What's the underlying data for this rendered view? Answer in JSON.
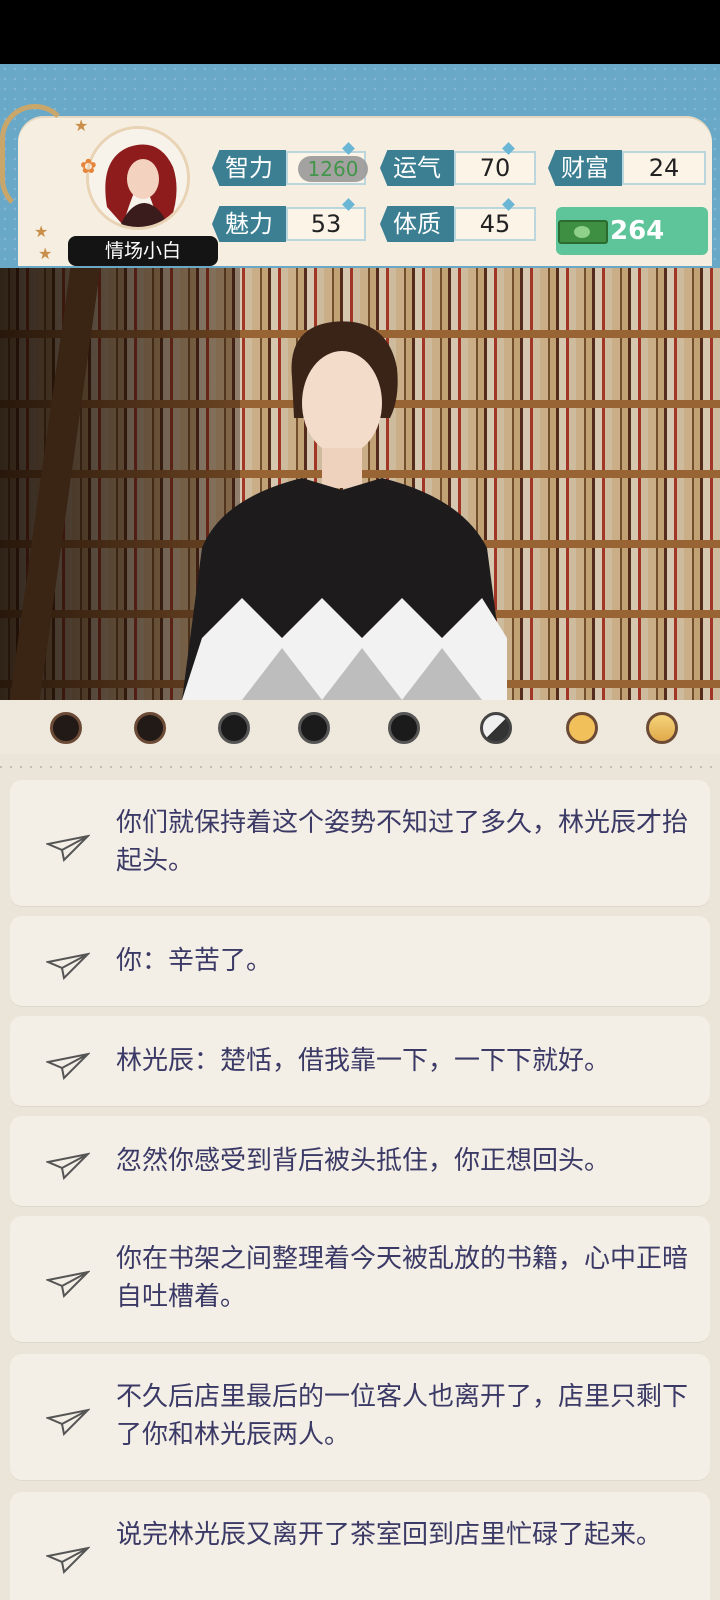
{
  "player": {
    "name": "情场小白"
  },
  "stats": {
    "intelligence": {
      "label": "智力",
      "value": "1260"
    },
    "luck": {
      "label": "运气",
      "value": "70"
    },
    "wealth": {
      "label": "财富",
      "value": "24"
    },
    "charm": {
      "label": "魅力",
      "value": "53"
    },
    "physique": {
      "label": "体质",
      "value": "45"
    }
  },
  "money": {
    "amount": "264"
  },
  "indicator_dots": [
    {
      "state": "dark"
    },
    {
      "state": "dark"
    },
    {
      "state": "dark"
    },
    {
      "state": "dark"
    },
    {
      "state": "dark"
    },
    {
      "state": "half"
    },
    {
      "state": "gold"
    },
    {
      "state": "gold"
    }
  ],
  "log": [
    "你们就保持着这个姿势不知过了多久，林光辰才抬起头。",
    "你：辛苦了。",
    "林光辰：楚恬，借我靠一下，一下下就好。",
    "忽然你感受到背后被头抵住，你正想回头。",
    "你在书架之间整理着今天被乱放的书籍，心中正暗自吐槽着。",
    "不久后店里最后的一位客人也离开了，店里只剩下了你和林光辰两人。",
    "说完林光辰又离开了茶室回到店里忙碌了起来。"
  ],
  "colors": {
    "stat_label": "#3c7f93",
    "log_text": "#3b3a66",
    "money": "#5ec59a"
  }
}
